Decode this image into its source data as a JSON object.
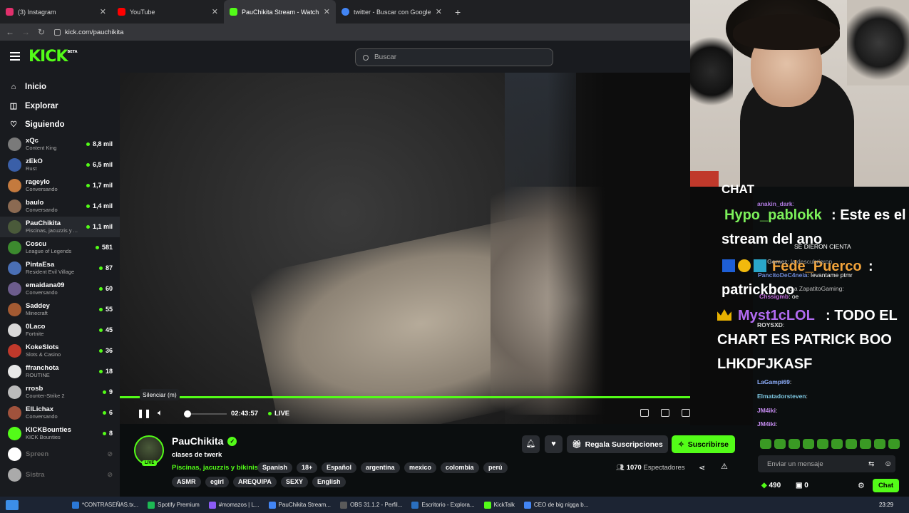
{
  "browser": {
    "tabs": [
      {
        "title": "(3) Instagram",
        "color": "#e1306c",
        "active": false
      },
      {
        "title": "YouTube",
        "color": "#ff0000",
        "active": false
      },
      {
        "title": "PauChikita Stream - Watch Live",
        "color": "#53fc18",
        "active": true
      },
      {
        "title": "twitter - Buscar con Google",
        "color": "#4285f4",
        "active": false
      }
    ],
    "url": "kick.com/pauchikita"
  },
  "header": {
    "logo": "KICK",
    "logo_badge": "BETA",
    "search_placeholder": "Buscar"
  },
  "nav": [
    {
      "label": "Inicio",
      "icon": "home-icon",
      "glyph": "⌂"
    },
    {
      "label": "Explorar",
      "icon": "compass-icon",
      "glyph": "◫"
    },
    {
      "label": "Siguiendo",
      "icon": "heart-icon",
      "glyph": "♡"
    }
  ],
  "channels": [
    {
      "name": "xQc",
      "category": "Content King",
      "viewers": "8,8 mil",
      "color": "#7a7a7a",
      "live": true
    },
    {
      "name": "zEkO",
      "category": "Rust",
      "viewers": "6,5 mil",
      "color": "#3a5fa8",
      "live": true
    },
    {
      "name": "rageylo",
      "category": "Conversando",
      "viewers": "1,7 mil",
      "color": "#c47a3e",
      "live": true
    },
    {
      "name": "baulo",
      "category": "Conversando",
      "viewers": "1,4 mil",
      "color": "#8b6a52",
      "live": true
    },
    {
      "name": "PauChikita",
      "category": "Piscinas, jacuzzis y ...",
      "viewers": "1,1 mil",
      "color": "#4a5a3a",
      "live": true
    },
    {
      "name": "Coscu",
      "category": "League of Legends",
      "viewers": "581",
      "color": "#3c8a2e",
      "live": true
    },
    {
      "name": "PintaEsa",
      "category": "Resident Evil Village",
      "viewers": "87",
      "color": "#4a6fb5",
      "live": true
    },
    {
      "name": "emaidana09",
      "category": "Conversando",
      "viewers": "60",
      "color": "#6c5c8c",
      "live": true
    },
    {
      "name": "Saddey",
      "category": "Minecraft",
      "viewers": "55",
      "color": "#a35a32",
      "live": true
    },
    {
      "name": "0Laco",
      "category": "Fortnite",
      "viewers": "45",
      "color": "#d9d9d9",
      "live": true
    },
    {
      "name": "KokeSlots",
      "category": "Slots & Casino",
      "viewers": "36",
      "color": "#c0392b",
      "live": true
    },
    {
      "name": "ffranchota",
      "category": "ROUTINE",
      "viewers": "18",
      "color": "#e8e8e8",
      "live": true
    },
    {
      "name": "rrosb",
      "category": "Counter-Strike 2",
      "viewers": "9",
      "color": "#bbbbbb",
      "live": true
    },
    {
      "name": "ElLichax",
      "category": "Conversando",
      "viewers": "6",
      "color": "#a0523c",
      "live": true
    },
    {
      "name": "KICKBounties",
      "category": "KICK Bounties",
      "viewers": "8",
      "color": "#53fc18",
      "live": true
    },
    {
      "name": "Spreen",
      "category": "",
      "viewers": "",
      "color": "#ffffff",
      "live": false
    },
    {
      "name": "Sistra",
      "category": "",
      "viewers": "",
      "color": "#aaaaaa",
      "live": false
    }
  ],
  "player": {
    "tooltip": "Silenciar (m)",
    "time": "02:43:57",
    "live": "LIVE",
    "progress": 1.0,
    "volume": 0.05
  },
  "stream": {
    "channel": "PauChikita",
    "title": "clases de twerk",
    "category": "Piscinas, jacuzzis y bikinis",
    "live_badge": "LIVE",
    "tags_row1": [
      "Spanish",
      "18+",
      "Español",
      "argentina",
      "mexico",
      "colombia",
      "perú"
    ],
    "tags_row2": [
      "ASMR",
      "egirl",
      "AREQUIPA",
      "SEXY",
      "English"
    ],
    "gift_label": "Regala Suscripciones",
    "subscribe_label": "Suscribirse",
    "viewers_count": "1070",
    "viewers_label": "Espectadores"
  },
  "chat_overlay": {
    "line_chat": "CHAT",
    "msg1_user": "Hypo_pablokk",
    "msg1_text": ": Este es el",
    "msg1_text2": "stream del ano",
    "msg2_user": "Fede_Puerco",
    "msg2_colon": ":",
    "msg2_text": "patrickboo",
    "msg3_user": "Myst1cLOL",
    "msg3_text": ": TODO EL",
    "msg3_text2": "CHART ES PATRICK BOO",
    "msg3_text3": "LHKDFJKASF",
    "small": [
      {
        "user": "anakin_dark",
        "text": ":"
      },
      {
        "user": "",
        "text": "SE DIERON CIENTA"
      },
      {
        "user": "Gomez",
        "text": ": la descubrieron"
      },
      {
        "user": "PancitoDeC4neia",
        "text": ": levantame ptmr"
      },
      {
        "user": "",
        "text": "do a ZapatitoGaming:"
      },
      {
        "user": "Chssigmb",
        "text": ": oe"
      },
      {
        "user": "ROYSXD",
        "text": ":"
      },
      {
        "user": "LaGampi69",
        "text": ":"
      },
      {
        "user": "Elmatadorsteven",
        "text": ":"
      },
      {
        "user": "JM4iki",
        "text": ":"
      },
      {
        "user": "JM4iki",
        "text": ":"
      }
    ]
  },
  "chat": {
    "input_placeholder": "Enviar un mensaje",
    "points": "490",
    "count": "0",
    "chat_button": "Chat"
  },
  "taskbar": {
    "items": [
      "*CONTRASEÑAS.tx...",
      "Spotify Premium",
      "#momazos | L...",
      "PauChikita Stream...",
      "OBS 31.1.2 - Perfil...",
      "Escritorio - Explora...",
      "KickTalk",
      "CEO de big nigga b..."
    ],
    "clock": "23:29"
  }
}
